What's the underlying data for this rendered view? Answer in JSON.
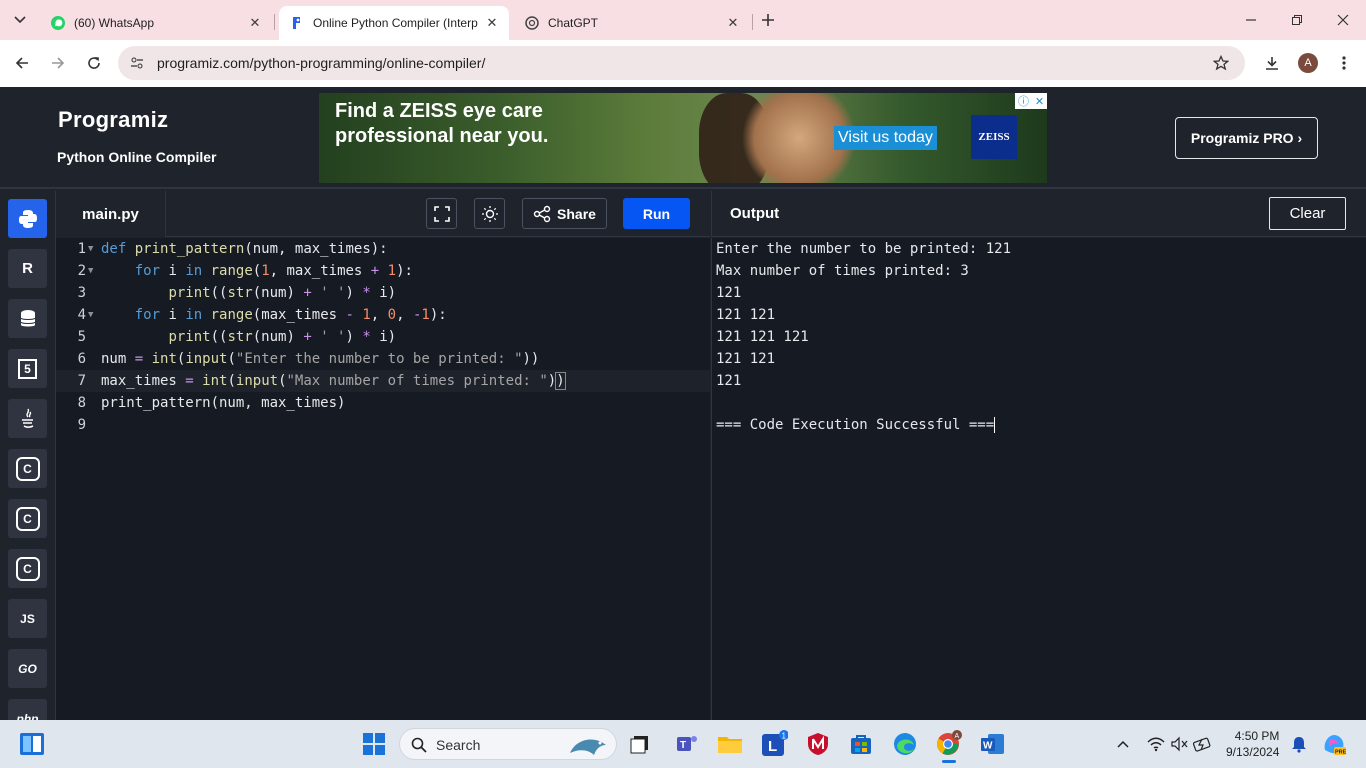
{
  "browser": {
    "tabs": [
      {
        "title": "(60) WhatsApp",
        "icon": "whatsapp-icon"
      },
      {
        "title": "Online Python Compiler (Interp",
        "icon": "programiz-icon",
        "active": true
      },
      {
        "title": "ChatGPT",
        "icon": "chatgpt-icon"
      }
    ],
    "url": "programiz.com/python-programming/online-compiler/",
    "profile_initial": "A"
  },
  "header": {
    "logo": "Programiz",
    "subtitle": "Python Online Compiler",
    "pro_button": "Programiz PRO ›"
  },
  "ad": {
    "headline_1": "Find a ZEISS eye care",
    "headline_2": "professional near you.",
    "cta": "Visit us today",
    "brand": "ZEISS"
  },
  "sidebar": {
    "languages": [
      {
        "name": "python",
        "label": "",
        "active": true
      },
      {
        "name": "r",
        "label": "R"
      },
      {
        "name": "sql",
        "label": ""
      },
      {
        "name": "html",
        "label": "5"
      },
      {
        "name": "java",
        "label": ""
      },
      {
        "name": "c",
        "label": "C"
      },
      {
        "name": "cpp",
        "label": "C"
      },
      {
        "name": "csharp",
        "label": "C"
      },
      {
        "name": "js",
        "label": "JS"
      },
      {
        "name": "go",
        "label": "GO"
      },
      {
        "name": "php",
        "label": "php"
      }
    ]
  },
  "editor": {
    "filename": "main.py",
    "share_label": "Share",
    "run_label": "Run",
    "line_numbers": [
      "1",
      "2",
      "3",
      "4",
      "5",
      "6",
      "7",
      "8",
      "9"
    ]
  },
  "output": {
    "title": "Output",
    "clear_label": "Clear",
    "lines": [
      "Enter the number to be printed: 121",
      "Max number of times printed: 3",
      "121",
      "121 121",
      "121 121 121",
      "121 121",
      "121",
      "",
      "=== Code Execution Successful ==="
    ]
  },
  "taskbar": {
    "search_placeholder": "Search",
    "time": "4:50 PM",
    "date": "9/13/2024"
  }
}
